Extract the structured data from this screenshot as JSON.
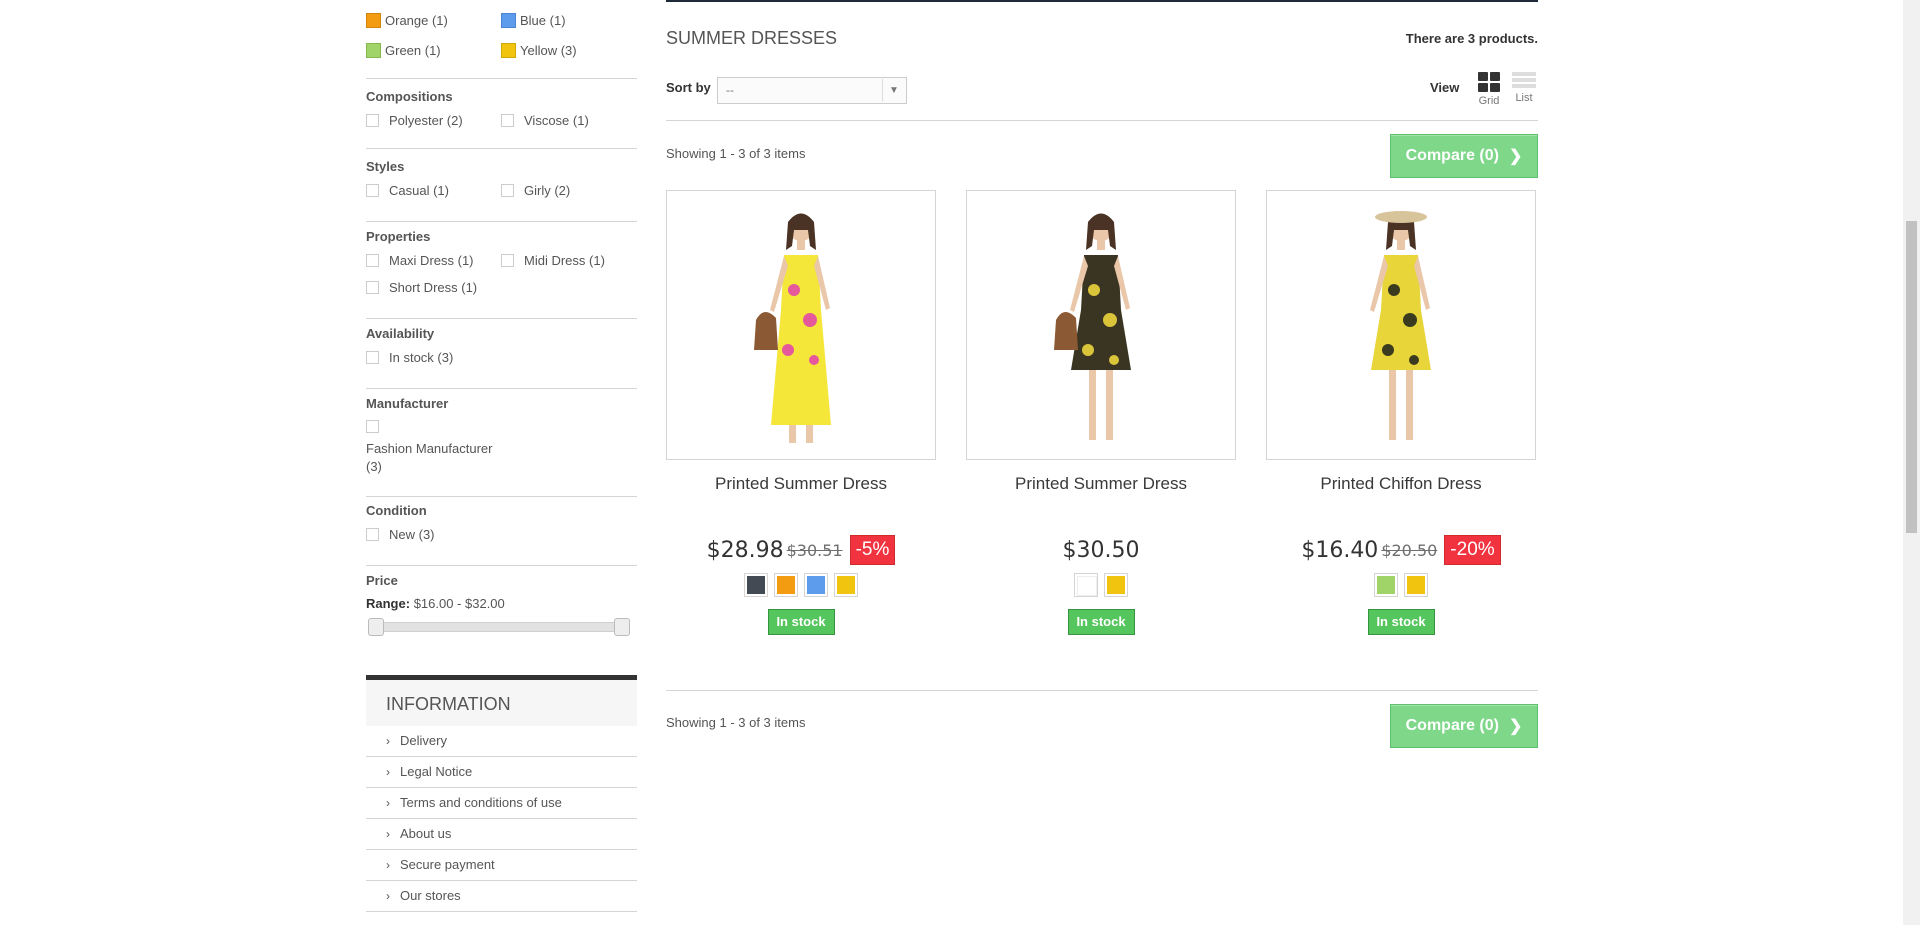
{
  "sidebar": {
    "colors": [
      {
        "label": "Orange (1)",
        "color": "#f39c11"
      },
      {
        "label": "Blue (1)",
        "color": "#5d9cec"
      },
      {
        "label": "Green (1)",
        "color": "#a0d468"
      },
      {
        "label": "Yellow (3)",
        "color": "#f1c40f"
      }
    ],
    "compositions": {
      "title": "Compositions",
      "items": [
        "Polyester (2)",
        "Viscose (1)"
      ]
    },
    "styles": {
      "title": "Styles",
      "items": [
        "Casual (1)",
        "Girly (2)"
      ]
    },
    "properties": {
      "title": "Properties",
      "items": [
        "Maxi Dress (1)",
        "Midi Dress (1)",
        "Short Dress (1)"
      ]
    },
    "availability": {
      "title": "Availability",
      "items": [
        "In stock (3)"
      ]
    },
    "manufacturer": {
      "title": "Manufacturer",
      "items": [
        "Fashion Manufacturer (3)"
      ]
    },
    "condition": {
      "title": "Condition",
      "items": [
        "New (3)"
      ]
    },
    "price": {
      "title": "Price",
      "range_label": "Range:",
      "range_value": "$16.00 - $32.00",
      "min_fraction": 0,
      "max_fraction": 1
    },
    "information": {
      "title": "Information",
      "items": [
        "Delivery",
        "Legal Notice",
        "Terms and conditions of use",
        "About us",
        "Secure payment",
        "Our stores"
      ]
    }
  },
  "main": {
    "category_title": "Summer Dresses",
    "products_count": "There are 3 products.",
    "sort_label": "Sort by",
    "sort_value": "--",
    "view_label": "View",
    "view_grid": "Grid",
    "view_list": "List",
    "showing_top": "Showing 1 - 3 of 3 items",
    "showing_bottom": "Showing 1 - 3 of 3 items",
    "compare_label": "Compare (0)",
    "products": [
      {
        "name": "Printed Summer Dress",
        "price": "$28.98",
        "old_price": "$30.51",
        "discount": "-5%",
        "swatches": [
          "#434a54",
          "#f39c11",
          "#5d9cec",
          "#f1c40f"
        ],
        "stock": "In stock",
        "dress_color": "#f5e63a",
        "dress_pattern": "#e5589c"
      },
      {
        "name": "Printed Summer Dress",
        "price": "$30.50",
        "old_price": "",
        "discount": "",
        "swatches": [
          "#ffffff",
          "#f1c40f"
        ],
        "stock": "In stock",
        "dress_color": "#3a3522",
        "dress_pattern": "#d9c43a"
      },
      {
        "name": "Printed Chiffon Dress",
        "price": "$16.40",
        "old_price": "$20.50",
        "discount": "-20%",
        "swatches": [
          "#a0d468",
          "#f1c40f"
        ],
        "stock": "In stock",
        "dress_color": "#e8d53a",
        "dress_pattern": "#3b3b1f"
      }
    ]
  }
}
